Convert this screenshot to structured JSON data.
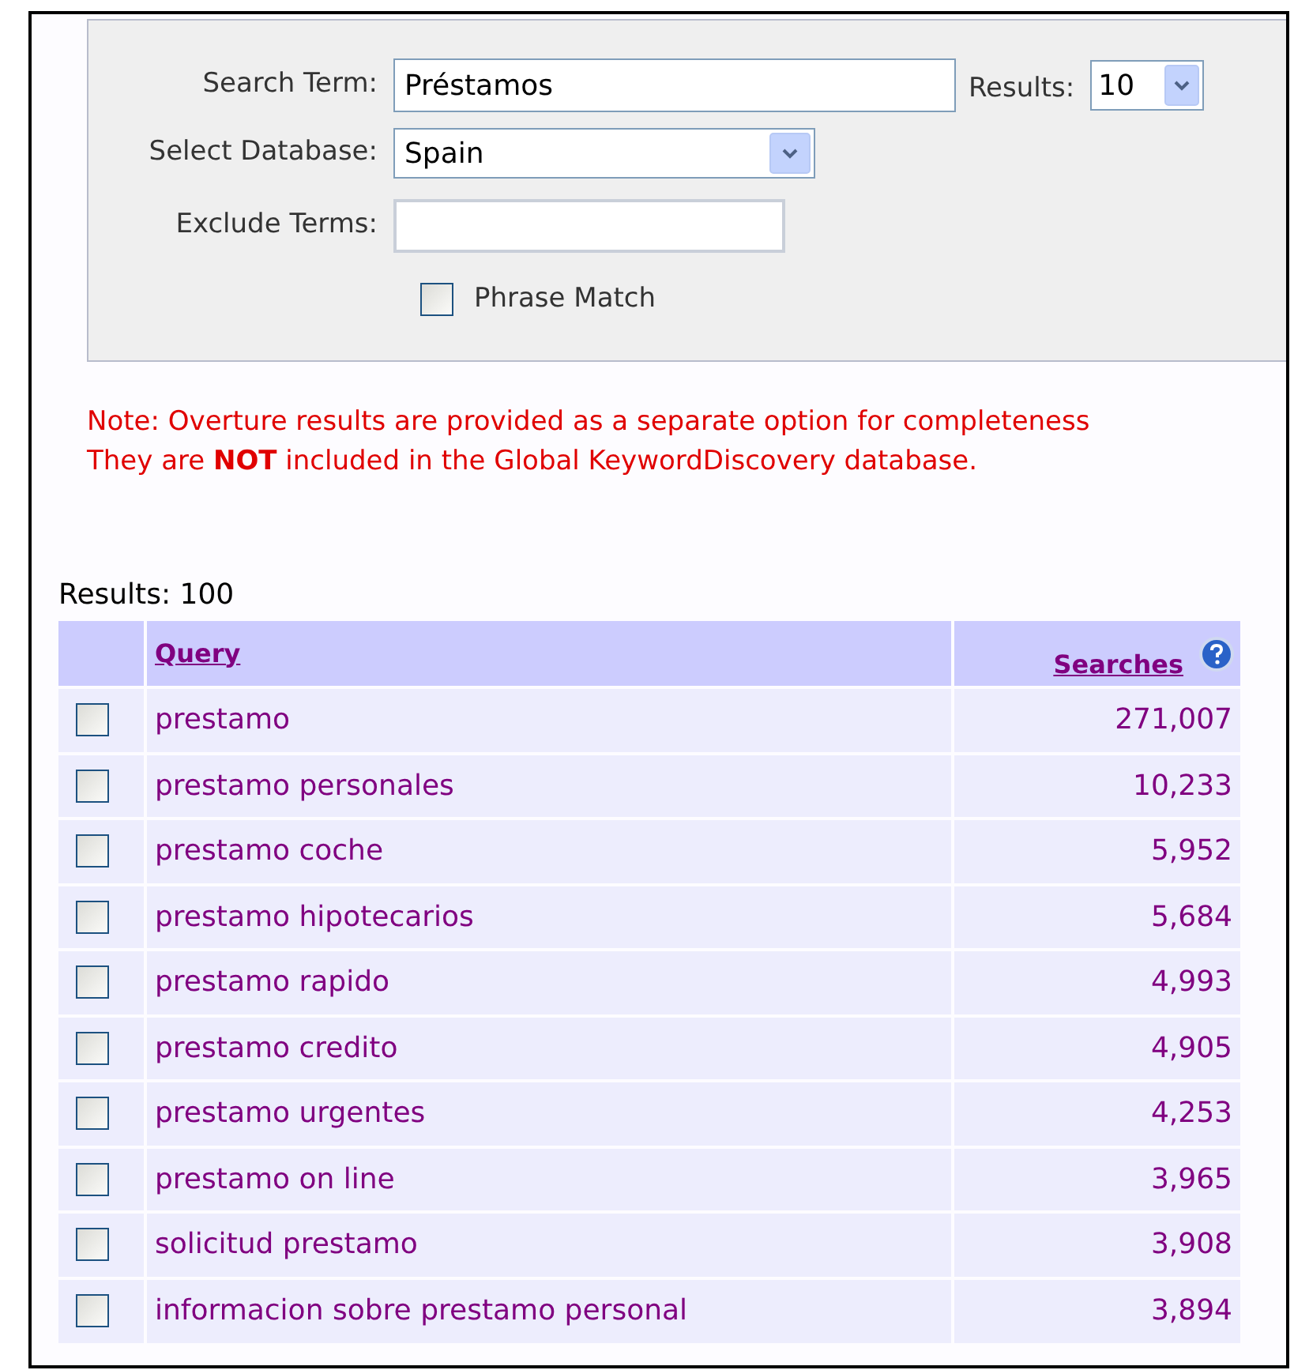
{
  "search_form": {
    "search_term": {
      "label": "Search Term:",
      "value": "Préstamos"
    },
    "results_select": {
      "label": "Results:",
      "value": "10"
    },
    "database_select": {
      "label": "Select Database:",
      "value": "Spain"
    },
    "exclude_terms": {
      "label": "Exclude Terms:"
    },
    "phrase_match": {
      "label": "Phrase Match",
      "checked": false
    }
  },
  "note": [
    "Note: Overture results are provided as a separate option for completeness",
    "They are **NOT** included in the Global KeywordDiscovery database."
  ],
  "results_count": "Results: 100",
  "table": {
    "columns": [
      "Query",
      "Searches"
    ],
    "rows": [
      {
        "query": "prestamo",
        "searches": "271,007",
        "checked": false
      },
      {
        "query": "prestamo personales",
        "searches": "10,233",
        "checked": false
      },
      {
        "query": "prestamo coche",
        "searches": "5,952",
        "checked": false
      },
      {
        "query": "prestamo hipotecarios",
        "searches": "5,684",
        "checked": false
      },
      {
        "query": "prestamo rapido",
        "searches": "4,993",
        "checked": false
      },
      {
        "query": "prestamo credito",
        "searches": "4,905",
        "checked": false
      },
      {
        "query": "prestamo urgentes",
        "searches": "4,253",
        "checked": false
      },
      {
        "query": "prestamo on line",
        "searches": "3,965",
        "checked": false
      },
      {
        "query": "solicitud prestamo",
        "searches": "3,908",
        "checked": false
      },
      {
        "query": "informacion sobre prestamo personal",
        "searches": "3,894",
        "checked": false
      }
    ]
  }
}
